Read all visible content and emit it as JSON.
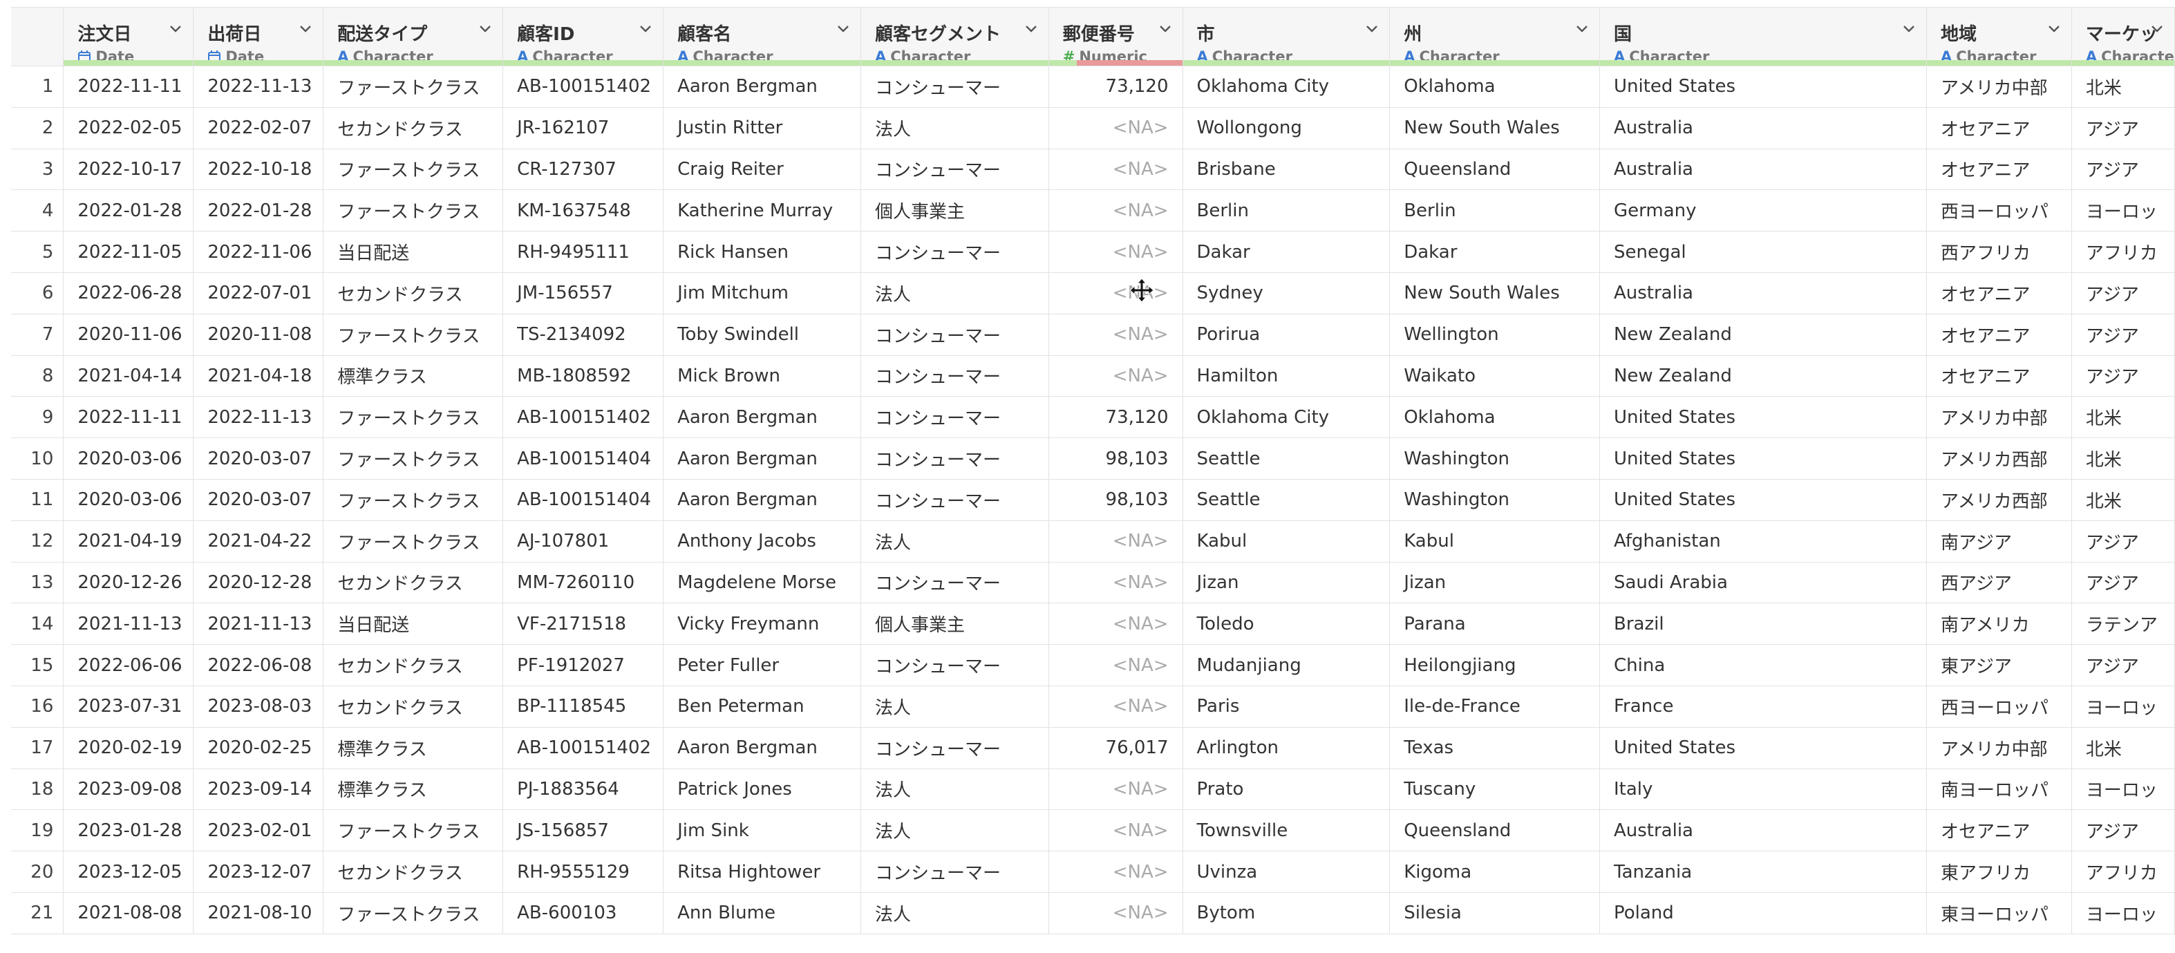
{
  "columns": [
    {
      "name": "注文日",
      "type": "Date"
    },
    {
      "name": "出荷日",
      "type": "Date"
    },
    {
      "name": "配送タイプ",
      "type": "Character"
    },
    {
      "name": "顧客ID",
      "type": "Character"
    },
    {
      "name": "顧客名",
      "type": "Character"
    },
    {
      "name": "顧客セグメント",
      "type": "Character"
    },
    {
      "name": "郵便番号",
      "type": "Numeric"
    },
    {
      "name": "市",
      "type": "Character"
    },
    {
      "name": "州",
      "type": "Character"
    },
    {
      "name": "国",
      "type": "Character"
    },
    {
      "name": "地域",
      "type": "Character"
    },
    {
      "name": "マーケッ",
      "type": "Characte"
    }
  ],
  "icons": {
    "date": "calendar-icon",
    "character": "character-a-icon",
    "numeric": "hash-icon",
    "menu": "chevron-down-icon",
    "cursor": "move-cursor-icon"
  },
  "colors": {
    "quality_bar_valid": "#bfe8a8",
    "quality_bar_missing": "#e89a9a",
    "type_icon_blue": "#3a7bd5",
    "type_icon_green": "#4caf50"
  },
  "postal_missing_fraction": 0.79,
  "rows": [
    [
      "1",
      "2022-11-11",
      "2022-11-13",
      "ファーストクラス",
      "AB-100151402",
      "Aaron Bergman",
      "コンシューマー",
      "73,120",
      "Oklahoma City",
      "Oklahoma",
      "United States",
      "アメリカ中部",
      "北米"
    ],
    [
      "2",
      "2022-02-05",
      "2022-02-07",
      "セカンドクラス",
      "JR-162107",
      "Justin Ritter",
      "法人",
      "<NA>",
      "Wollongong",
      "New South Wales",
      "Australia",
      "オセアニア",
      "アジア"
    ],
    [
      "3",
      "2022-10-17",
      "2022-10-18",
      "ファーストクラス",
      "CR-127307",
      "Craig Reiter",
      "コンシューマー",
      "<NA>",
      "Brisbane",
      "Queensland",
      "Australia",
      "オセアニア",
      "アジア"
    ],
    [
      "4",
      "2022-01-28",
      "2022-01-28",
      "ファーストクラス",
      "KM-1637548",
      "Katherine Murray",
      "個人事業主",
      "<NA>",
      "Berlin",
      "Berlin",
      "Germany",
      "西ヨーロッパ",
      "ヨーロッ"
    ],
    [
      "5",
      "2022-11-05",
      "2022-11-06",
      "当日配送",
      "RH-9495111",
      "Rick Hansen",
      "コンシューマー",
      "<NA>",
      "Dakar",
      "Dakar",
      "Senegal",
      "西アフリカ",
      "アフリカ"
    ],
    [
      "6",
      "2022-06-28",
      "2022-07-01",
      "セカンドクラス",
      "JM-156557",
      "Jim Mitchum",
      "法人",
      "<NA>",
      "Sydney",
      "New South Wales",
      "Australia",
      "オセアニア",
      "アジア"
    ],
    [
      "7",
      "2020-11-06",
      "2020-11-08",
      "ファーストクラス",
      "TS-2134092",
      "Toby Swindell",
      "コンシューマー",
      "<NA>",
      "Porirua",
      "Wellington",
      "New Zealand",
      "オセアニア",
      "アジア"
    ],
    [
      "8",
      "2021-04-14",
      "2021-04-18",
      "標準クラス",
      "MB-1808592",
      "Mick Brown",
      "コンシューマー",
      "<NA>",
      "Hamilton",
      "Waikato",
      "New Zealand",
      "オセアニア",
      "アジア"
    ],
    [
      "9",
      "2022-11-11",
      "2022-11-13",
      "ファーストクラス",
      "AB-100151402",
      "Aaron Bergman",
      "コンシューマー",
      "73,120",
      "Oklahoma City",
      "Oklahoma",
      "United States",
      "アメリカ中部",
      "北米"
    ],
    [
      "10",
      "2020-03-06",
      "2020-03-07",
      "ファーストクラス",
      "AB-100151404",
      "Aaron Bergman",
      "コンシューマー",
      "98,103",
      "Seattle",
      "Washington",
      "United States",
      "アメリカ西部",
      "北米"
    ],
    [
      "11",
      "2020-03-06",
      "2020-03-07",
      "ファーストクラス",
      "AB-100151404",
      "Aaron Bergman",
      "コンシューマー",
      "98,103",
      "Seattle",
      "Washington",
      "United States",
      "アメリカ西部",
      "北米"
    ],
    [
      "12",
      "2021-04-19",
      "2021-04-22",
      "ファーストクラス",
      "AJ-107801",
      "Anthony Jacobs",
      "法人",
      "<NA>",
      "Kabul",
      "Kabul",
      "Afghanistan",
      "南アジア",
      "アジア"
    ],
    [
      "13",
      "2020-12-26",
      "2020-12-28",
      "セカンドクラス",
      "MM-7260110",
      "Magdelene Morse",
      "コンシューマー",
      "<NA>",
      "Jizan",
      "Jizan",
      "Saudi Arabia",
      "西アジア",
      "アジア"
    ],
    [
      "14",
      "2021-11-13",
      "2021-11-13",
      "当日配送",
      "VF-2171518",
      "Vicky Freymann",
      "個人事業主",
      "<NA>",
      "Toledo",
      "Parana",
      "Brazil",
      "南アメリカ",
      "ラテンア"
    ],
    [
      "15",
      "2022-06-06",
      "2022-06-08",
      "セカンドクラス",
      "PF-1912027",
      "Peter Fuller",
      "コンシューマー",
      "<NA>",
      "Mudanjiang",
      "Heilongjiang",
      "China",
      "東アジア",
      "アジア"
    ],
    [
      "16",
      "2023-07-31",
      "2023-08-03",
      "セカンドクラス",
      "BP-1118545",
      "Ben Peterman",
      "法人",
      "<NA>",
      "Paris",
      "Ile-de-France",
      "France",
      "西ヨーロッパ",
      "ヨーロッ"
    ],
    [
      "17",
      "2020-02-19",
      "2020-02-25",
      "標準クラス",
      "AB-100151402",
      "Aaron Bergman",
      "コンシューマー",
      "76,017",
      "Arlington",
      "Texas",
      "United States",
      "アメリカ中部",
      "北米"
    ],
    [
      "18",
      "2023-09-08",
      "2023-09-14",
      "標準クラス",
      "PJ-1883564",
      "Patrick Jones",
      "法人",
      "<NA>",
      "Prato",
      "Tuscany",
      "Italy",
      "南ヨーロッパ",
      "ヨーロッ"
    ],
    [
      "19",
      "2023-01-28",
      "2023-02-01",
      "ファーストクラス",
      "JS-156857",
      "Jim Sink",
      "法人",
      "<NA>",
      "Townsville",
      "Queensland",
      "Australia",
      "オセアニア",
      "アジア"
    ],
    [
      "20",
      "2023-12-05",
      "2023-12-07",
      "セカンドクラス",
      "RH-9555129",
      "Ritsa Hightower",
      "コンシューマー",
      "<NA>",
      "Uvinza",
      "Kigoma",
      "Tanzania",
      "東アフリカ",
      "アフリカ"
    ],
    [
      "21",
      "2021-08-08",
      "2021-08-10",
      "ファーストクラス",
      "AB-600103",
      "Ann Blume",
      "法人",
      "<NA>",
      "Bytom",
      "Silesia",
      "Poland",
      "東ヨーロッパ",
      "ヨーロッ"
    ]
  ]
}
